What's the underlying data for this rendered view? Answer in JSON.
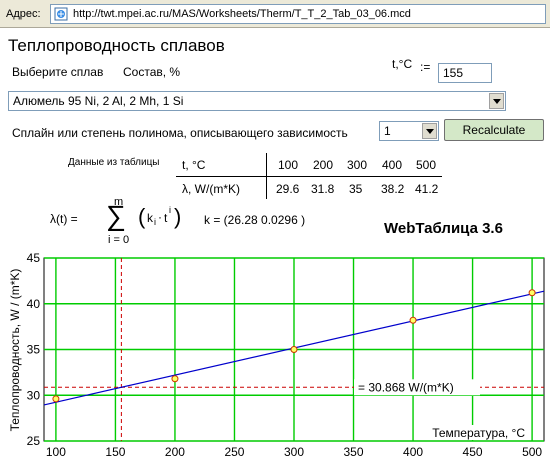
{
  "browser": {
    "address_label": "Адрес:",
    "url": "http://twt.mpei.ac.ru/MAS/Worksheets/Therm/T_T_2_Tab_03_06.mcd"
  },
  "page": {
    "title": "Теплопроводность сплавов"
  },
  "controls": {
    "choose_alloy_label": "Выберите сплав",
    "composition_label": "Состав, %",
    "t_label": "t,°C",
    "t_assign": ":=",
    "t_value": "155",
    "alloy_selected": "Алюмель 95 Ni, 2 Al, 2 Mh, 1 Si",
    "spline_label": "Сплайн или степень полинома, описывающего зависимость",
    "degree_selected": "1",
    "recalc_label": "Recalculate"
  },
  "table": {
    "title": "Данные из таблицы",
    "row1_label": "t, °C",
    "row2_label": "λ, W/(m*K)",
    "t_values": [
      "100",
      "200",
      "300",
      "400",
      "500"
    ],
    "lambda_values": [
      "29.6",
      "31.8",
      "35",
      "38.2",
      "41.2"
    ]
  },
  "formula": {
    "lhs": "λ(t) =",
    "sum_top": "m",
    "sum_bottom": "i = 0",
    "term": "k",
    "term_sub": "i",
    "term_var": "t",
    "term_sup": "i",
    "k_text": "k = (26.28   0.0296 )"
  },
  "web_title": "WebТаблица 3.6",
  "chart_data": {
    "type": "scatter",
    "title": "",
    "xlabel": "Температура, °C",
    "ylabel": "Теплопроводность, W / (m*K)",
    "xlim": [
      90,
      510
    ],
    "ylim": [
      25,
      45
    ],
    "x_ticks": [
      100,
      150,
      200,
      250,
      300,
      350,
      400,
      450,
      500
    ],
    "y_ticks": [
      25,
      30,
      35,
      40,
      45
    ],
    "grid": true,
    "points": {
      "x": [
        100,
        200,
        300,
        400,
        500
      ],
      "y": [
        29.6,
        31.8,
        35,
        38.2,
        41.2
      ]
    },
    "fit_line": {
      "x": [
        90,
        510
      ],
      "y": [
        28.944,
        41.376
      ],
      "color": "#0000cc"
    },
    "marker_x": 155,
    "marker_y": 30.868,
    "marker_label": "= 30.868 W/(m*K)",
    "colors": {
      "grid": "#00cc00",
      "points": "#cc3300",
      "marker": "#cc0000",
      "line": "#0000cc"
    }
  }
}
